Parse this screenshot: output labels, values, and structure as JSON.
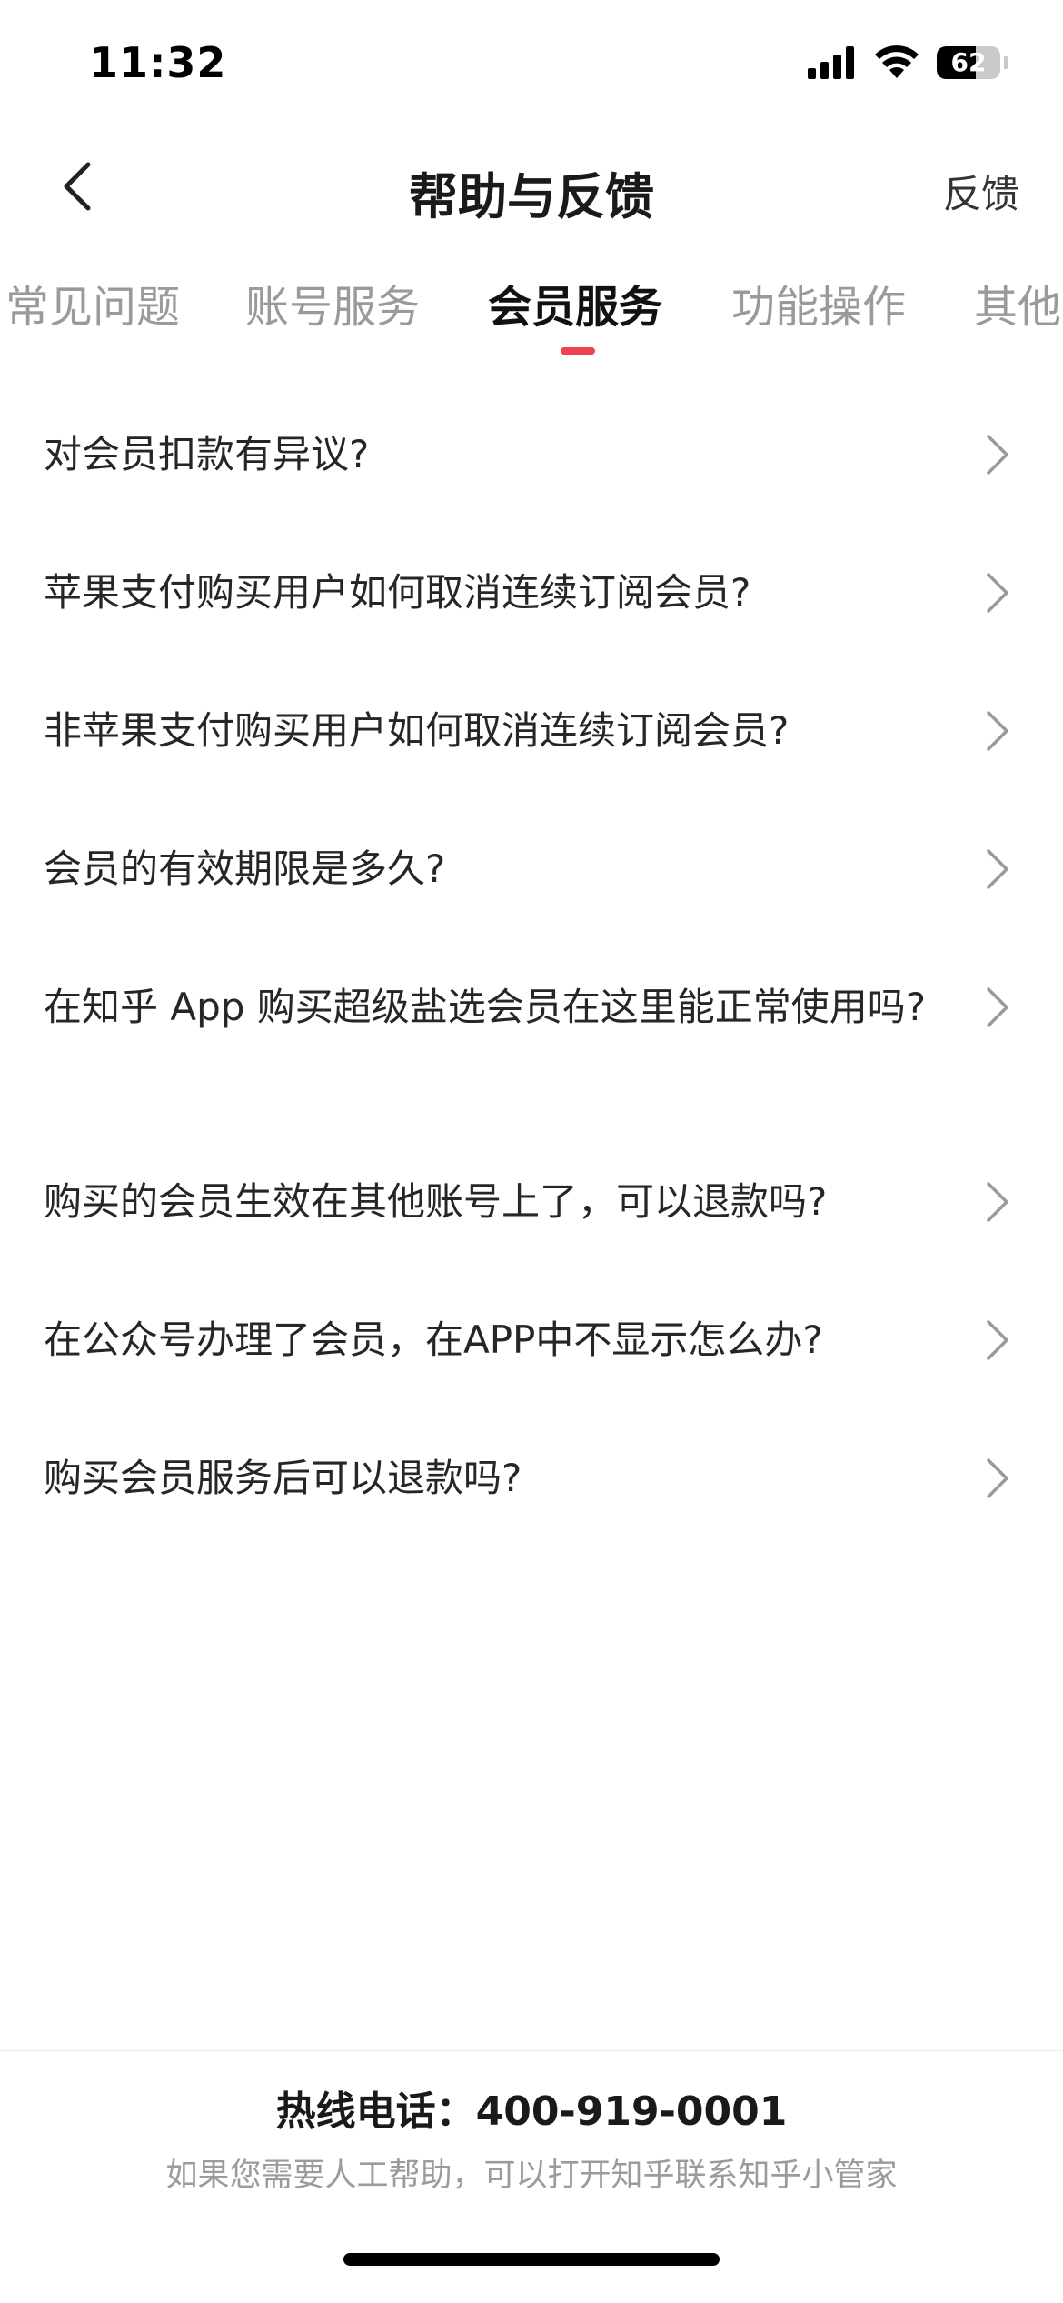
{
  "status_bar": {
    "time": "11:32",
    "battery_text": "62",
    "battery_level_percent": 62,
    "icons": [
      "signal-icon",
      "wifi-icon",
      "battery-icon"
    ]
  },
  "header": {
    "back_icon": "chevron-left-icon",
    "title": "帮助与反馈",
    "feedback_label": "反馈"
  },
  "tabs": [
    {
      "label": "常见问题"
    },
    {
      "label": "账号服务"
    },
    {
      "label": "会员服务",
      "active": true
    },
    {
      "label": "功能操作"
    },
    {
      "label": "其他"
    }
  ],
  "faq": [
    {
      "question": "对会员扣款有异议?"
    },
    {
      "question": "苹果支付购买用户如何取消连续订阅会员?"
    },
    {
      "question": "非苹果支付购买用户如何取消连续订阅会员?"
    },
    {
      "question": "会员的有效期限是多久?"
    },
    {
      "question": "在知乎 App 购买超级盐选会员在这里能正常使用吗?"
    },
    {
      "question": "购买的会员生效在其他账号上了，可以退款吗?"
    },
    {
      "question": "在公众号办理了会员，在APP中不显示怎么办?"
    },
    {
      "question": "购买会员服务后可以退款吗?"
    }
  ],
  "footer": {
    "hotline": "热线电话：400-919-0001",
    "note": "如果您需要人工帮助，可以打开知乎联系知乎小管家"
  },
  "colors": {
    "accent": "#f0424d",
    "tab_inactive": "#9a9a9a",
    "note_text": "#9b9b9b"
  }
}
